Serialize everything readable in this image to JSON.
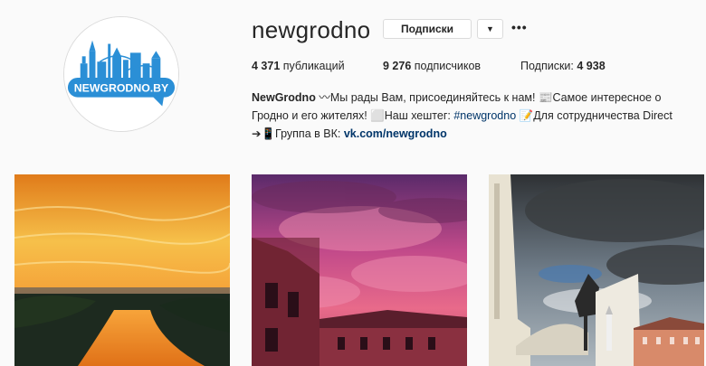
{
  "profile": {
    "username": "newgrodno",
    "avatar_text": "NEWGRODNO.BY",
    "follow_button": "Подписки",
    "caret": "▼",
    "more": "•••",
    "stats": {
      "posts_count": "4 371",
      "posts_label": "публикаций",
      "followers_count": "9 276",
      "followers_label": "подписчиков",
      "following_label": "Подписки:",
      "following_count": "4 938"
    },
    "bio": {
      "name": "NewGrodno",
      "line1_text": "〰Мы рады Вам, присоединяйтесь к нам! 📰Самое интересное о",
      "line2_text": "Гродно и его жителях! ⬜Наш хештег: ",
      "hashtag": "#newgrodno",
      "line2_rest": " 📝Для сотрудничества Direct",
      "line3_text": "➔📱Группа в ВК: ",
      "link": "vk.com/newgrodno"
    }
  },
  "posts": [
    {
      "name": "sunset-river-photo"
    },
    {
      "name": "pink-clouds-photo"
    },
    {
      "name": "monument-sky-photo"
    }
  ],
  "colors": {
    "background": "#fafafa",
    "text": "#262626",
    "link": "#003569",
    "avatar_brand": "#2b8fd6"
  }
}
